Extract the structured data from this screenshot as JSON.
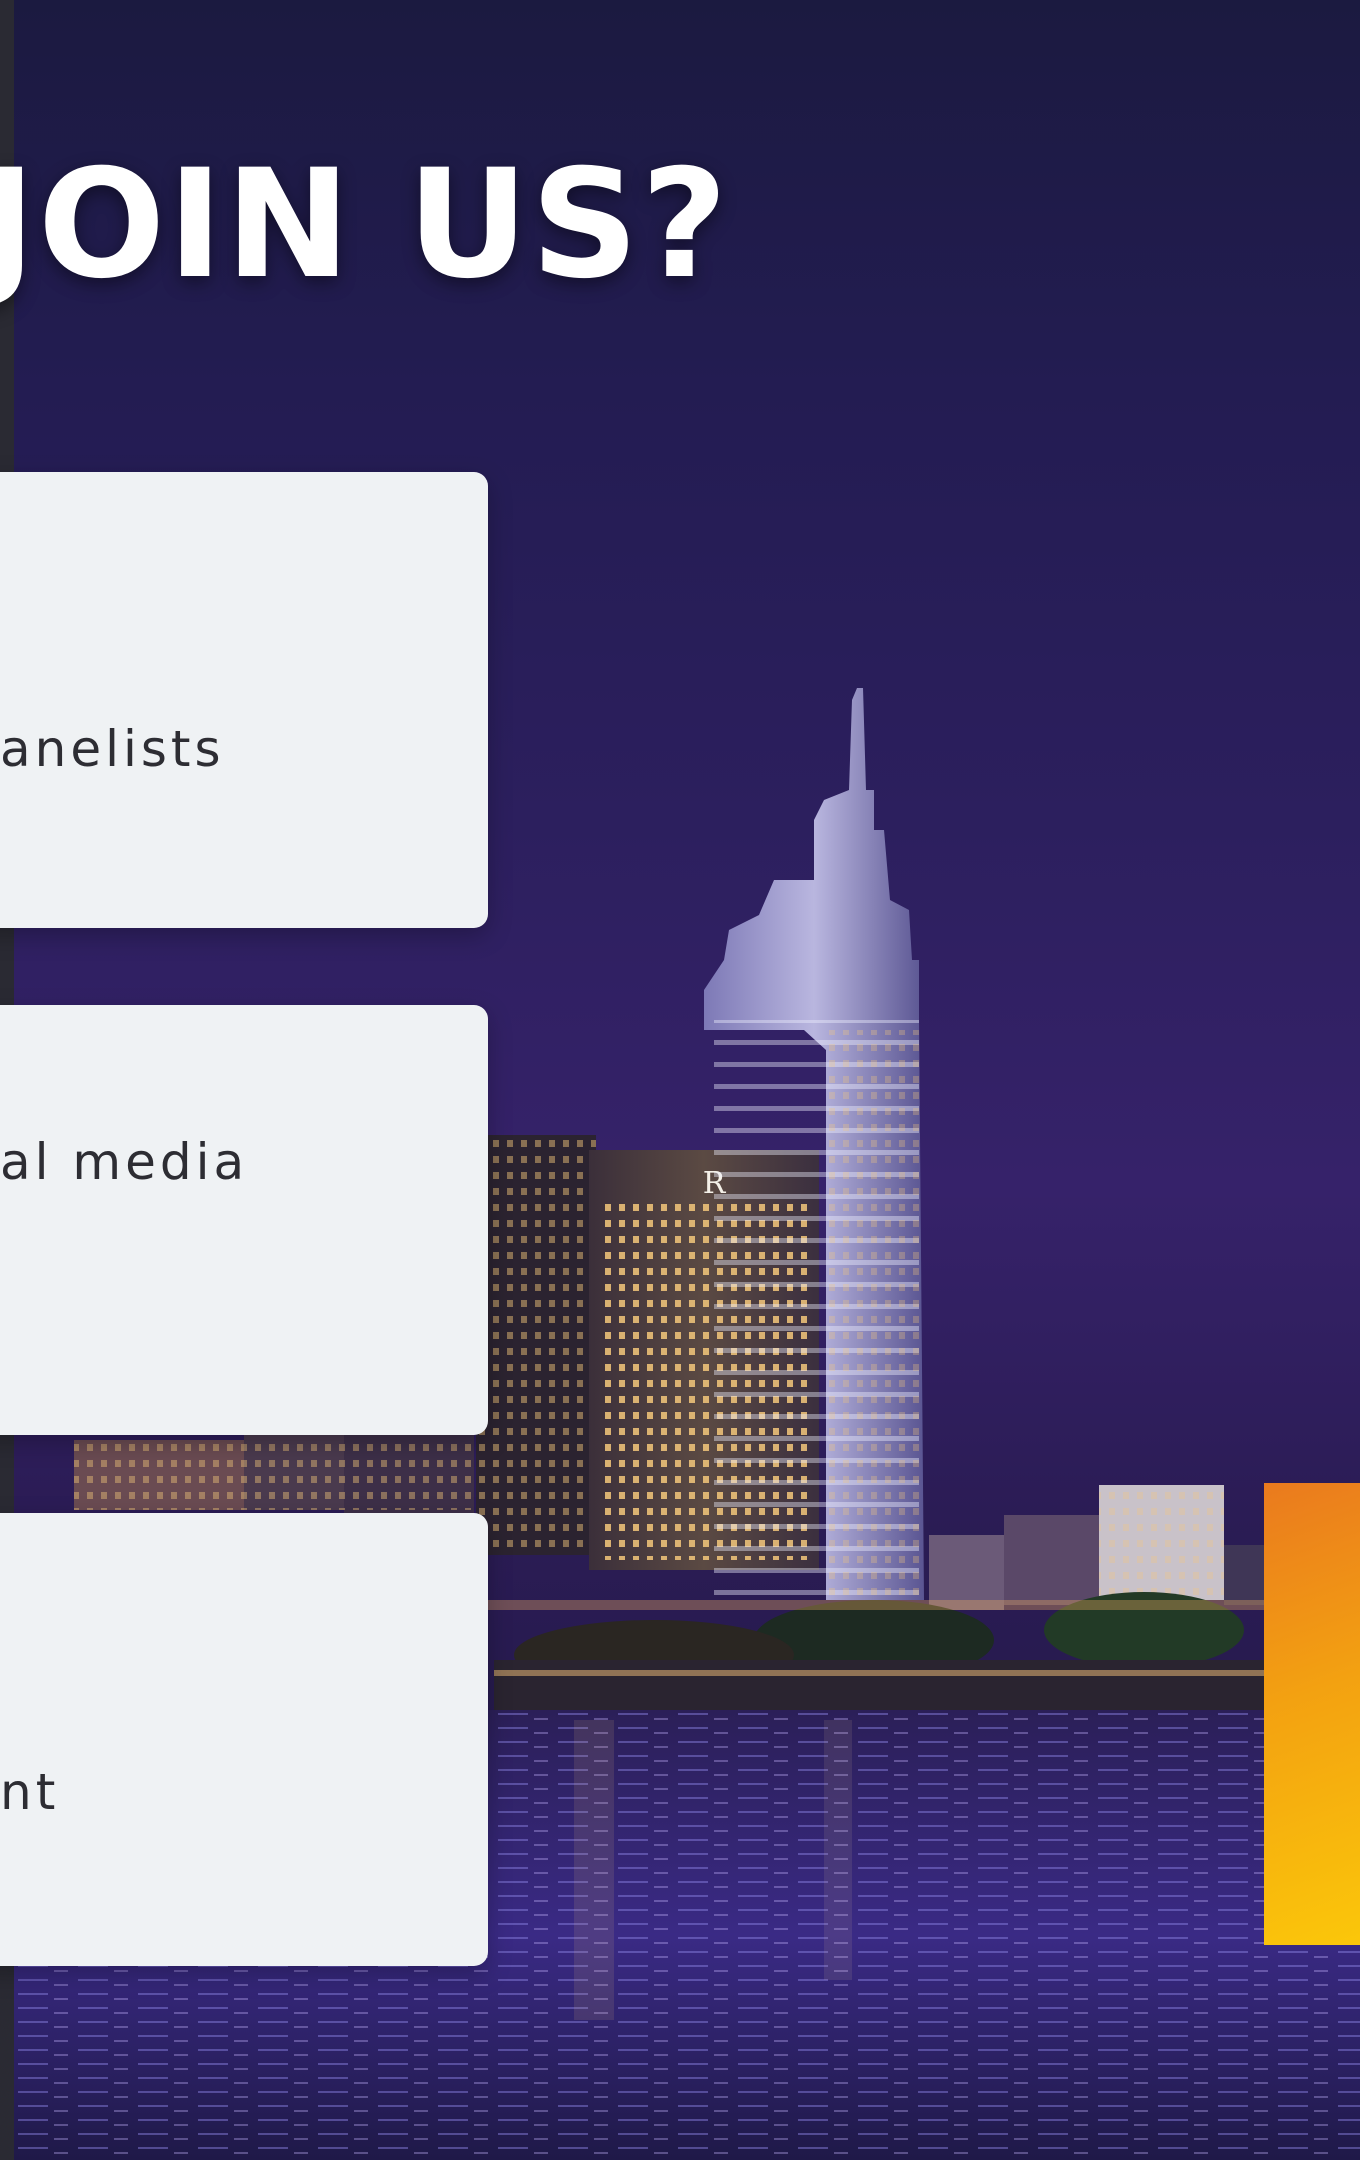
{
  "heading": "JOIN US?",
  "cards": [
    {
      "text": "anelists"
    },
    {
      "text": "al media"
    },
    {
      "text": "nt"
    }
  ],
  "colors": {
    "card_background": "#eff2f4",
    "heading_text": "#ffffff",
    "night_sky": "#2c1f5e",
    "accent_gradient_start": "#ea7a1e",
    "accent_gradient_end": "#fbc70a"
  }
}
